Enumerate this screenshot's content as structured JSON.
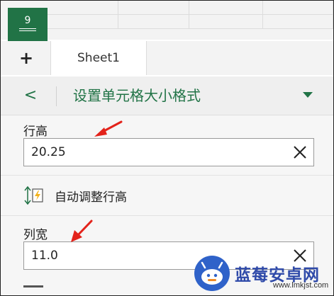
{
  "grid": {
    "selected_cell_value": "9"
  },
  "tabs": {
    "add_label": "+",
    "sheet_name": "Sheet1"
  },
  "panel": {
    "back_label": "<",
    "title": "设置单元格大小格式",
    "row_height": {
      "label": "行高",
      "value": "20.25"
    },
    "autofit": {
      "label": "自动调整行高"
    },
    "column_width": {
      "label": "列宽",
      "value": "11.0"
    }
  },
  "watermark": {
    "title": "蓝莓安卓网",
    "url": "www.lmkjst.com"
  },
  "colors": {
    "accent": "#217346",
    "annotation": "#e3231b",
    "watermark": "#2f4aa9"
  }
}
